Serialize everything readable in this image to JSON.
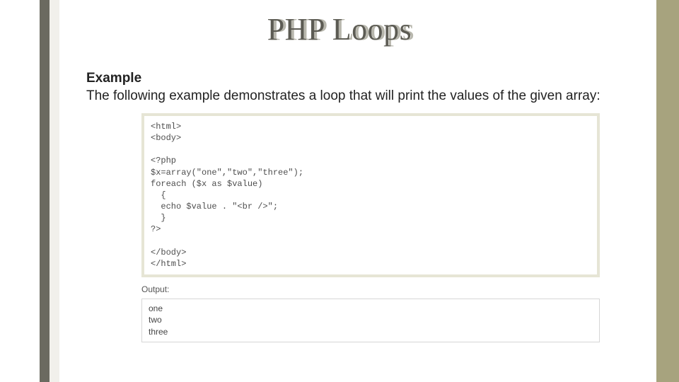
{
  "title": "PHP Loops",
  "example": {
    "heading": "Example",
    "description": "The following example demonstrates a loop that will print the values of the given array:"
  },
  "code": "<html>\n<body>\n\n<?php\n$x=array(\"one\",\"two\",\"three\");\nforeach ($x as $value)\n  {\n  echo $value . \"<br />\";\n  }\n?>\n\n</body>\n</html>",
  "outputLabel": "Output:",
  "output": "one\ntwo\nthree"
}
